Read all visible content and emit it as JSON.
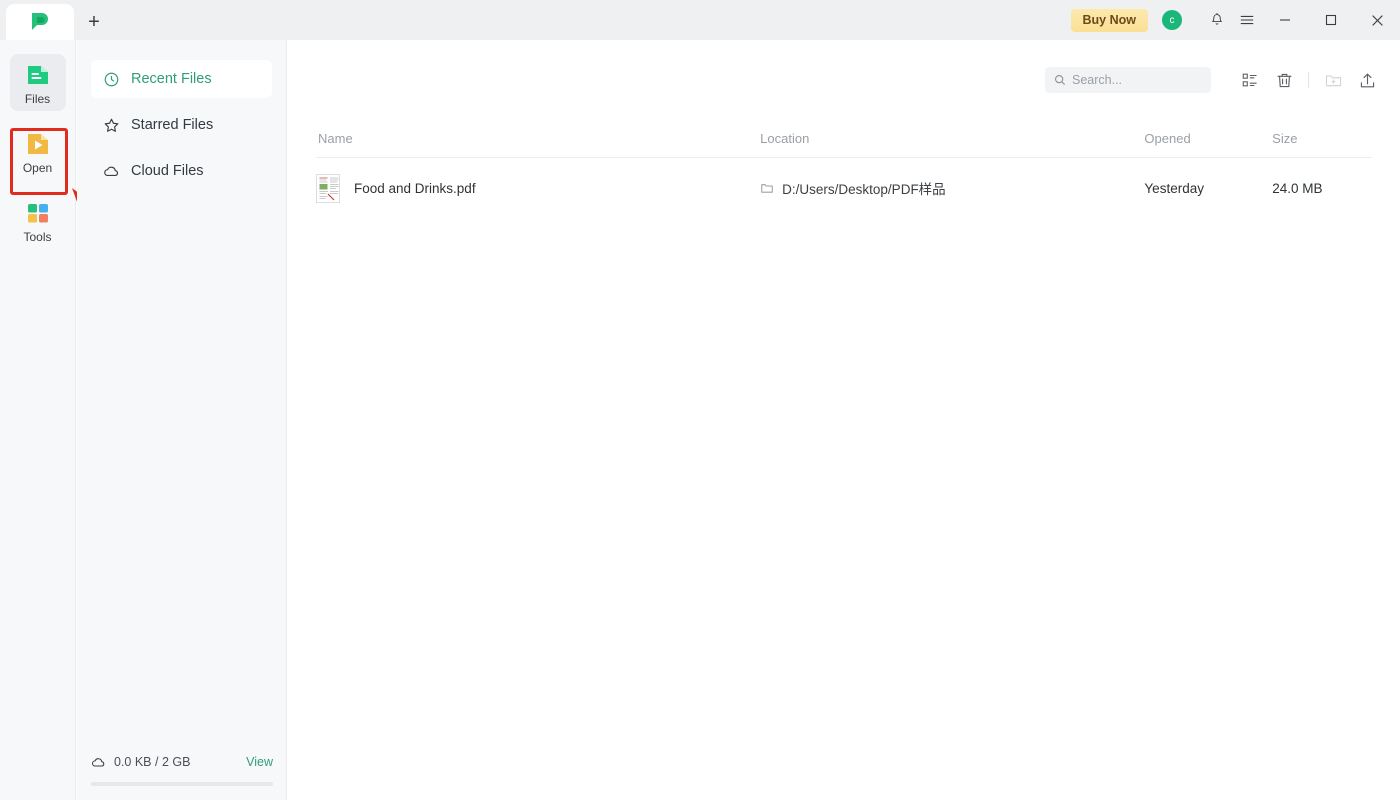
{
  "titlebar": {
    "new_tab_label": "+",
    "buy_now_label": "Buy Now",
    "avatar_initial": "c",
    "icons": {
      "notification": "bell-icon",
      "menu": "hamburger-menu-icon",
      "minimize": "minimize-icon",
      "maximize": "maximize-icon",
      "close": "close-icon"
    }
  },
  "rail": {
    "items": [
      {
        "label": "Files",
        "icon": "files-document-icon",
        "active": true
      },
      {
        "label": "Open",
        "icon": "open-play-document-icon",
        "active": false
      },
      {
        "label": "Tools",
        "icon": "tools-grid-icon",
        "active": false
      }
    ]
  },
  "annotation": {
    "highlight_target": "Open",
    "highlight_color": "#e02b1d",
    "arrow_color": "#e02b1d"
  },
  "sidebar": {
    "items": [
      {
        "label": "Recent Files",
        "icon": "clock-icon",
        "active": true
      },
      {
        "label": "Starred Files",
        "icon": "star-icon",
        "active": false
      },
      {
        "label": "Cloud Files",
        "icon": "cloud-icon",
        "active": false
      }
    ],
    "storage": {
      "icon": "cloud-icon",
      "text": "0.0 KB / 2 GB",
      "view_label": "View",
      "used_percent": 0
    }
  },
  "main": {
    "search": {
      "placeholder": "Search...",
      "value": "",
      "icon": "search-icon"
    },
    "toolbar_icons": [
      {
        "name": "list-view-icon",
        "disabled": false
      },
      {
        "name": "trash-icon",
        "disabled": false
      },
      {
        "name": "new-folder-icon",
        "disabled": true
      },
      {
        "name": "upload-icon",
        "disabled": false
      }
    ],
    "table": {
      "columns": [
        "Name",
        "Location",
        "Opened",
        "Size"
      ],
      "rows": [
        {
          "name": "Food and Drinks.pdf",
          "location": "D:/Users/Desktop/PDF样品",
          "opened": "Yesterday",
          "size": "24.0 MB",
          "thumb": "pdf-page-thumbnail"
        }
      ]
    }
  },
  "colors": {
    "brand_green": "#2f9e76",
    "accent_yellow": "#fbdf94",
    "annotation_red": "#e02b1d"
  }
}
